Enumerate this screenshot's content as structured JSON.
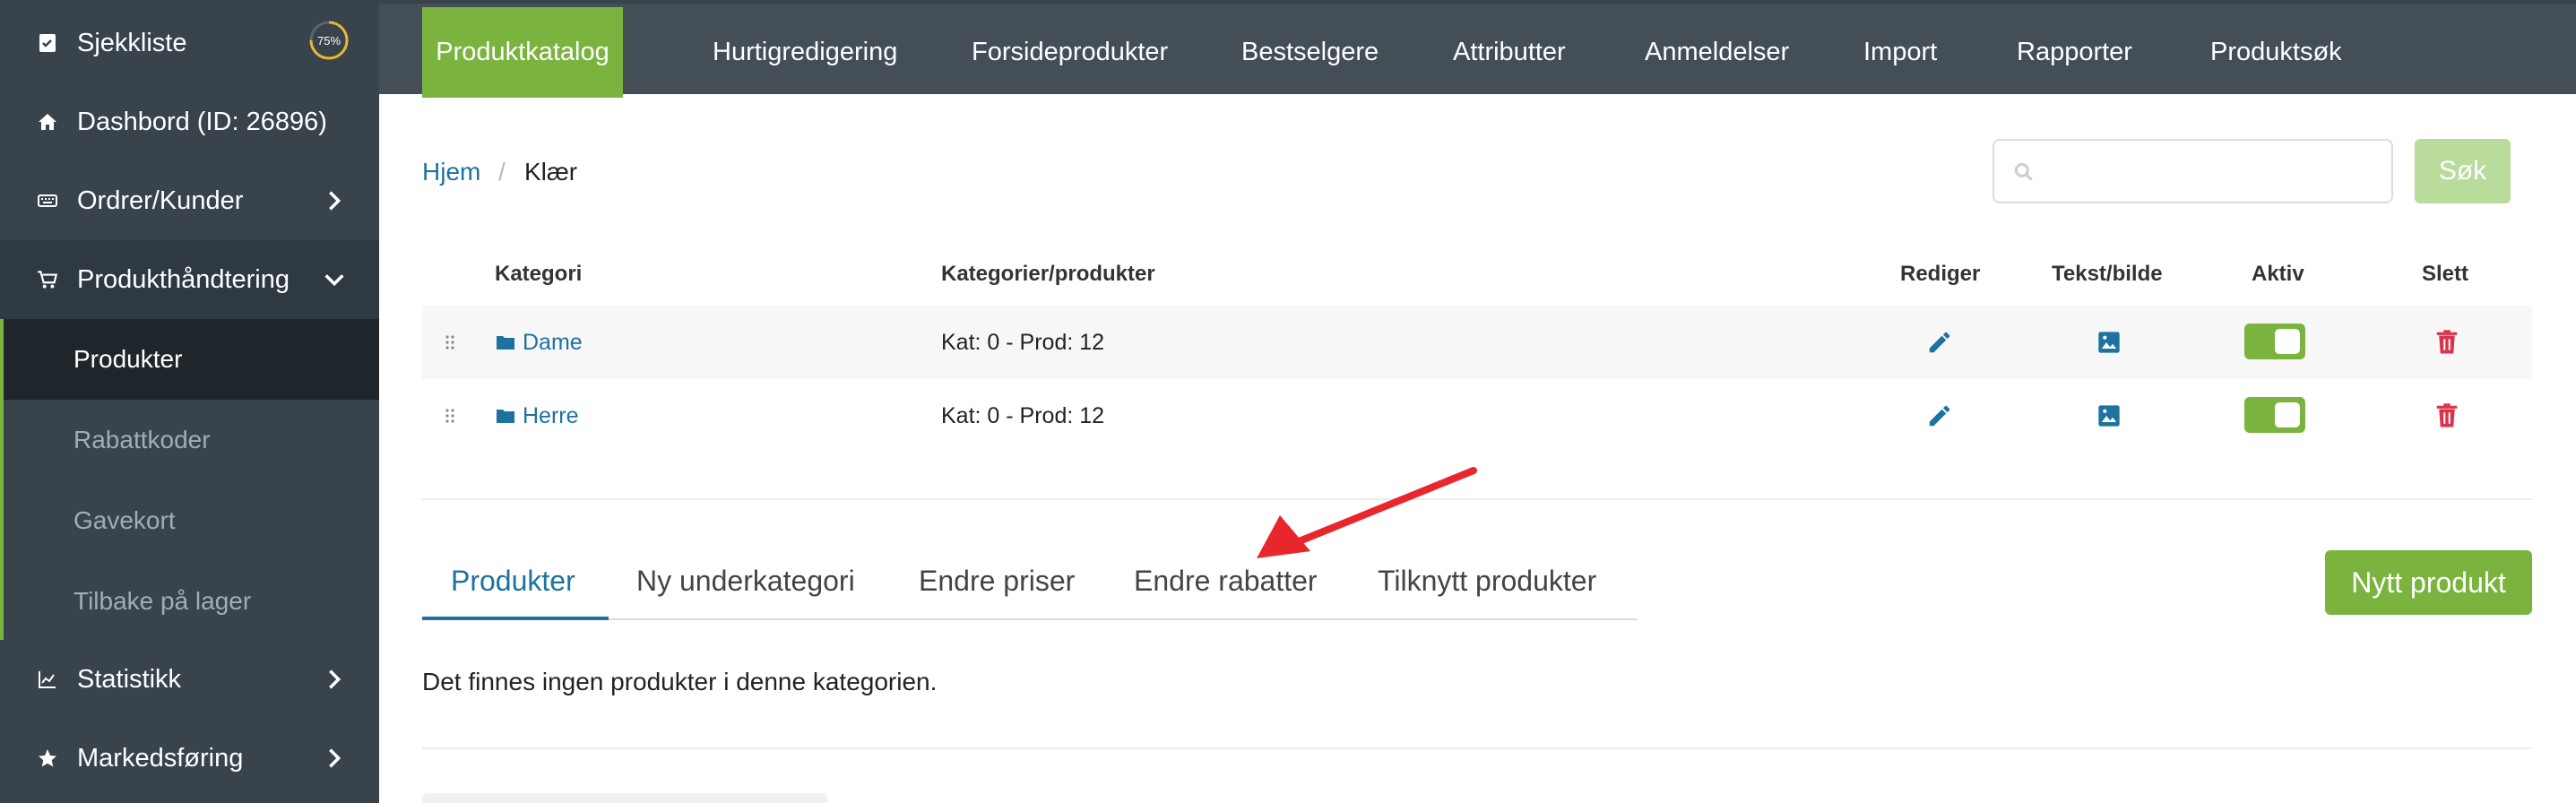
{
  "sidebar": {
    "items": [
      {
        "label": "Sjekkliste",
        "icon": "checklist-icon"
      },
      {
        "label": "Dashbord (ID: 26896)",
        "icon": "home-icon"
      },
      {
        "label": "Ordrer/Kunder",
        "icon": "keyboard-icon"
      },
      {
        "label": "Produkthåndtering",
        "icon": "cart-icon"
      },
      {
        "label": "Statistikk",
        "icon": "chart-icon"
      },
      {
        "label": "Markedsføring",
        "icon": "star-icon"
      }
    ],
    "progress_text": "75%",
    "progress_value": 0.75,
    "sub_items": [
      {
        "label": "Produkter"
      },
      {
        "label": "Rabattkoder"
      },
      {
        "label": "Gavekort"
      },
      {
        "label": "Tilbake på lager"
      }
    ]
  },
  "topnav": {
    "tabs": [
      {
        "label": "Produktkatalog"
      },
      {
        "label": "Hurtigredigering"
      },
      {
        "label": "Forsideprodukter"
      },
      {
        "label": "Bestselgere"
      },
      {
        "label": "Attributter"
      },
      {
        "label": "Anmeldelser"
      },
      {
        "label": "Import"
      },
      {
        "label": "Rapporter"
      },
      {
        "label": "Produktsøk"
      }
    ]
  },
  "breadcrumb": {
    "home": "Hjem",
    "separator": "/",
    "current": "Klær"
  },
  "search": {
    "placeholder": "",
    "button": "Søk"
  },
  "table": {
    "headers": {
      "category": "Kategori",
      "items": "Kategorier/produkter",
      "edit": "Rediger",
      "text_image": "Tekst/bilde",
      "active": "Aktiv",
      "delete": "Slett"
    },
    "rows": [
      {
        "name": "Dame",
        "count": "Kat: 0 - Prod: 12"
      },
      {
        "name": "Herre",
        "count": "Kat: 0 - Prod: 12"
      }
    ]
  },
  "subtabs": [
    {
      "label": "Produkter"
    },
    {
      "label": "Ny underkategori"
    },
    {
      "label": "Endre priser"
    },
    {
      "label": "Endre rabatter"
    },
    {
      "label": "Tilknytt produkter"
    }
  ],
  "new_product_button": "Nytt produkt",
  "empty_message": "Det finnes ingen produkter i denne kategorien.",
  "colors": {
    "accent_green": "#7ab43f",
    "sidebar_bg": "#38434c",
    "link_blue": "#1d72a0",
    "delete_red": "#d9344c",
    "arrow_red": "#e8262b"
  }
}
